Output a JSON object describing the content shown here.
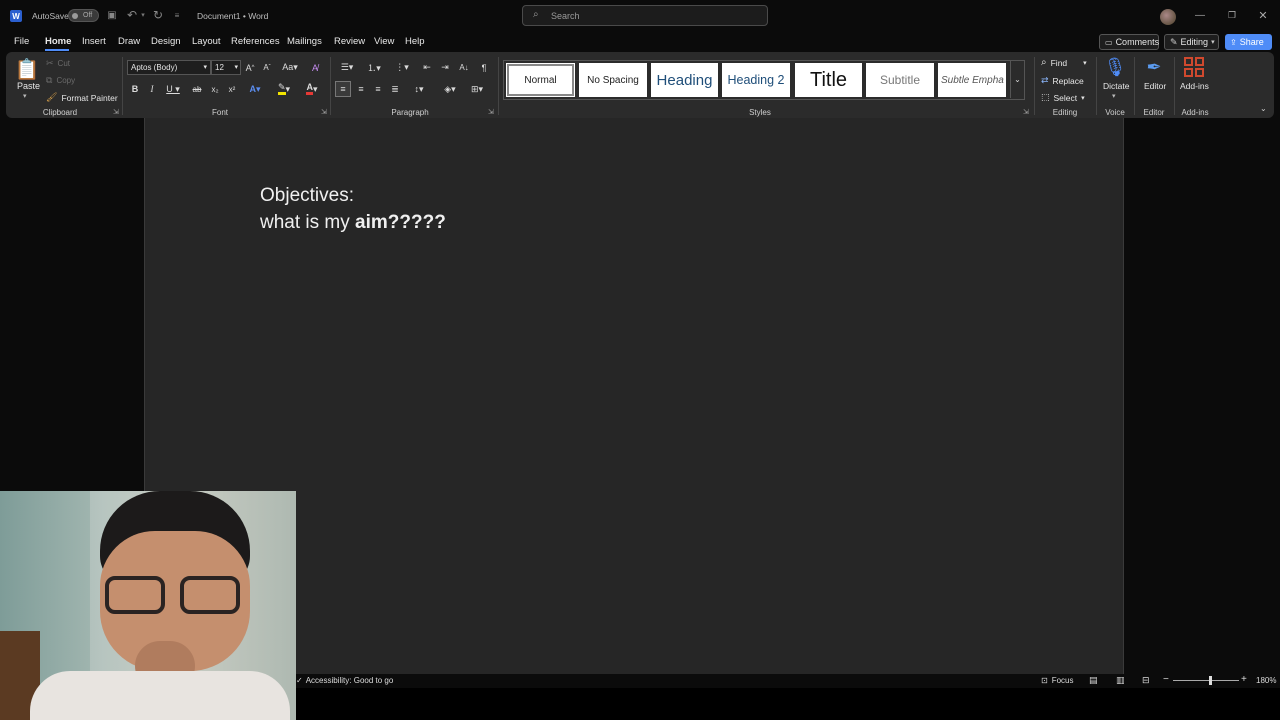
{
  "titlebar": {
    "autosave_label": "AutoSave",
    "autosave_state": "Off",
    "doc_title": "Document1",
    "app_sep": "•",
    "app_name": "Word",
    "search_placeholder": "Search"
  },
  "tabs": [
    "File",
    "Home",
    "Insert",
    "Draw",
    "Design",
    "Layout",
    "References",
    "Mailings",
    "Review",
    "View",
    "Help"
  ],
  "actions": {
    "comments": "Comments",
    "editing": "Editing",
    "share": "Share"
  },
  "clipboard": {
    "paste": "Paste",
    "cut": "Cut",
    "copy": "Copy",
    "format_painter": "Format Painter",
    "label": "Clipboard"
  },
  "font": {
    "name": "Aptos (Body)",
    "size": "12",
    "label": "Font"
  },
  "paragraph": {
    "label": "Paragraph"
  },
  "styles": {
    "label": "Styles",
    "items": [
      "Normal",
      "No Spacing",
      "Heading",
      "Heading 2",
      "Title",
      "Subtitle",
      "Subtle Empha"
    ]
  },
  "editing_group": {
    "find": "Find",
    "replace": "Replace",
    "select": "Select",
    "label": "Editing"
  },
  "voice": {
    "dictate": "Dictate",
    "label": "Voice"
  },
  "editor": {
    "button": "Editor",
    "label": "Editor"
  },
  "addins": {
    "button": "Add-ins",
    "label": "Add-ins"
  },
  "document": {
    "line1": "Objectives:",
    "line2_plain": "what is my ",
    "line2_bold": "aim?????"
  },
  "statusbar": {
    "accessibility": "Accessibility: Good to go",
    "focus": "Focus",
    "zoom": "180%"
  },
  "colors": {
    "accent": "#4f8cf7",
    "highlight": "#f2e400",
    "font_color": "#e53935"
  }
}
